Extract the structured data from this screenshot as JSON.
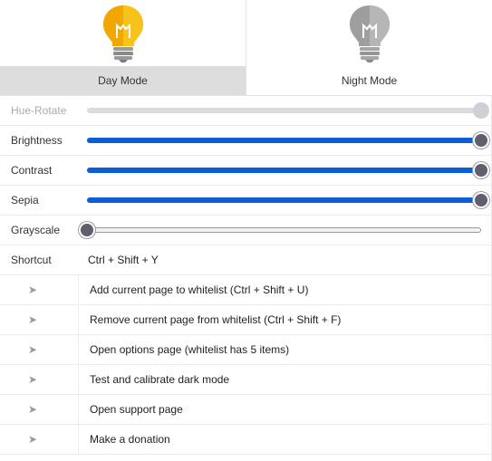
{
  "modes": {
    "day": {
      "label": "Day Mode",
      "icon": "lightbulb-on-icon",
      "active": true,
      "color": "#f5a800"
    },
    "night": {
      "label": "Night Mode",
      "icon": "lightbulb-off-icon",
      "active": false,
      "color": "#a8a8a8"
    }
  },
  "filters": {
    "hue_rotate": {
      "label": "Hue-Rotate",
      "value": 1.0,
      "disabled": true
    },
    "brightness": {
      "label": "Brightness",
      "value": 1.0
    },
    "contrast": {
      "label": "Contrast",
      "value": 1.0
    },
    "sepia": {
      "label": "Sepia",
      "value": 1.0
    },
    "grayscale": {
      "label": "Grayscale",
      "value": 0.0
    }
  },
  "shortcut": {
    "label": "Shortcut",
    "value": "Ctrl + Shift + Y"
  },
  "actions": [
    {
      "icon": "arrow-right-icon",
      "glyph": "➤",
      "label": "Add current page to whitelist (Ctrl + Shift + U)"
    },
    {
      "icon": "arrow-right-icon",
      "glyph": "➤",
      "label": "Remove current page from whitelist (Ctrl + Shift + F)"
    },
    {
      "icon": "arrow-right-icon",
      "glyph": "➤",
      "label": "Open options page (whitelist has 5 items)"
    },
    {
      "icon": "arrow-right-icon",
      "glyph": "➤",
      "label": "Test and calibrate dark mode"
    },
    {
      "icon": "arrow-right-icon",
      "glyph": "➤",
      "label": "Open support page"
    },
    {
      "icon": "arrow-right-icon",
      "glyph": "➤",
      "label": "Make a donation"
    }
  ],
  "colors": {
    "accent": "#0b5ed7",
    "thumb": "#5f5f6e",
    "active_band": "#dddddd"
  }
}
